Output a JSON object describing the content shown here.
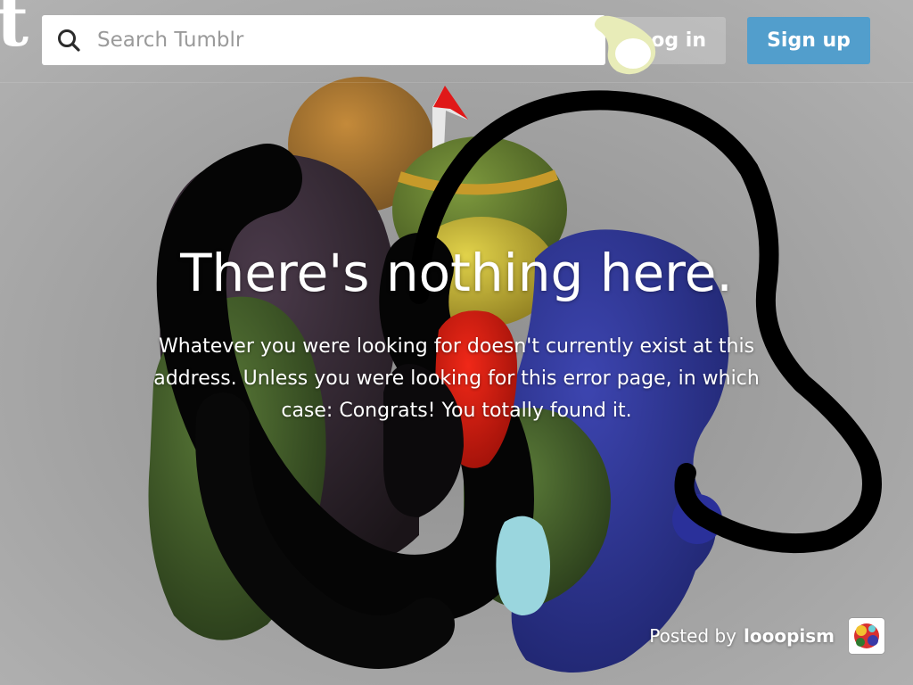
{
  "header": {
    "logo_letter": "t",
    "search": {
      "placeholder": "Search Tumblr",
      "value": ""
    },
    "login_label": "Log in",
    "signup_label": "Sign up"
  },
  "error": {
    "title": "There's nothing here.",
    "message": "Whatever you were looking for doesn't currently exist at this address. Unless you were looking for this error page, in which case: Congrats! You totally found it."
  },
  "credit": {
    "prefix": "Posted by",
    "author": "looopism"
  },
  "colors": {
    "background": "#a9a9a9",
    "signup_button": "#529ecc"
  },
  "icons": {
    "search": "search-icon",
    "avatar": "avatar"
  }
}
